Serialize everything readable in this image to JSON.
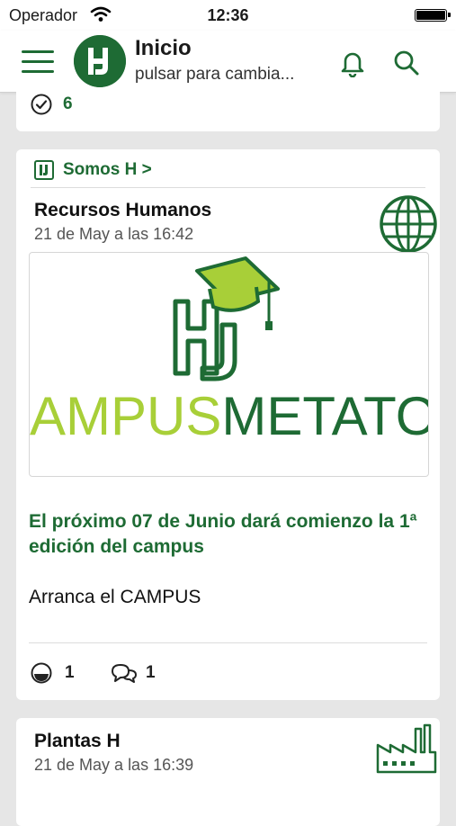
{
  "status_bar": {
    "carrier": "Operador",
    "time": "12:36"
  },
  "header": {
    "title": "Inicio",
    "subtitle": "pulsar para cambia...",
    "logo_letters": "HJ"
  },
  "card_top": {
    "count": "6"
  },
  "post": {
    "group_link": "Somos H >",
    "author": "Recursos Humanos",
    "date": "21 de May a las 16:42",
    "image_text_light": "AMPUS",
    "image_text_dark": "METATO",
    "title": "El próximo 07 de Junio dará comienzo la 1ª edición del campus",
    "body": "Arranca el CAMPUS",
    "reactions_count": "1",
    "comments_count": "1"
  },
  "next_post": {
    "author": "Plantas H",
    "date": "21 de May a las 16:39"
  },
  "colors": {
    "brand_green": "#1e6b34",
    "light_green": "#a8cf38",
    "background": "#e6e6e6"
  }
}
